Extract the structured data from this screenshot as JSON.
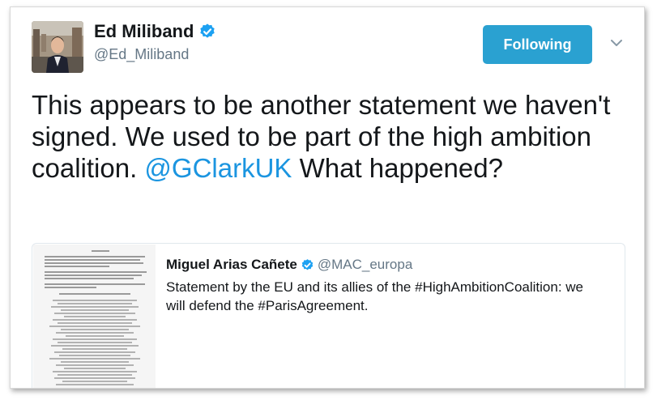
{
  "author": {
    "name": "Ed Miliband",
    "handle": "@Ed_Miliband",
    "verified_icon": "verified-badge-icon"
  },
  "follow_button": {
    "label": "Following"
  },
  "menu": {
    "icon": "chevron-down-icon"
  },
  "tweet": {
    "text_before": "This appears to be another statement we haven't signed. We used to be part of the high ambition coalition. ",
    "mention": "@GClarkUK",
    "text_after": " What happened?"
  },
  "quoted_tweet": {
    "name": "Miguel Arias Cañete",
    "handle": "@MAC_europa",
    "text": "Statement by the EU and its allies of the #HighAmbitionCoalition: we will defend the #ParisAgreement.",
    "thumbnail": "statement-document-image"
  },
  "colors": {
    "accent": "#2aa1d1",
    "link": "#1b95e0",
    "verified": "#1da1f2",
    "muted": "#657786"
  }
}
